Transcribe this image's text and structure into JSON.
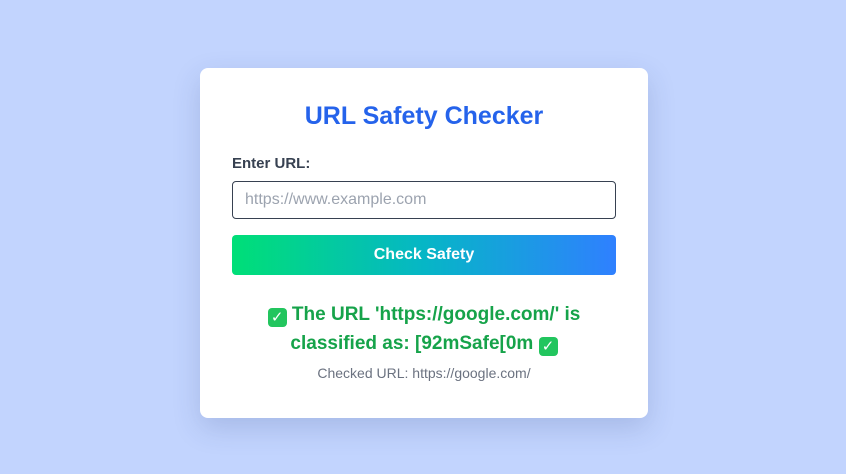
{
  "app": {
    "title": "URL Safety Checker"
  },
  "form": {
    "label": "Enter URL:",
    "input_value": "",
    "input_placeholder": "https://www.example.com",
    "button_label": "Check Safety"
  },
  "result": {
    "message": "The URL 'https://google.com/' is classified as: [92mSafe[0m",
    "icon": "check-mark-icon",
    "icon_glyph": "✓",
    "checked_url": "Checked URL: https://google.com/"
  },
  "colors": {
    "background": "#c2d4fe",
    "title": "#2563eb",
    "result_text": "#16a34a",
    "button_gradient_start": "#00df77",
    "button_gradient_end": "#2f80ff"
  }
}
